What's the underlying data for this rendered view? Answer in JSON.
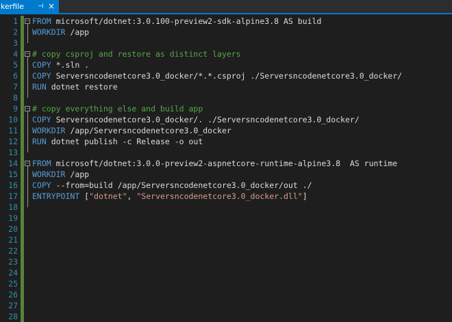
{
  "tab": {
    "title": "kerfile",
    "pin_icon": "pin-icon",
    "close_icon": "close-icon"
  },
  "colors": {
    "keyword": "#569cd6",
    "comment": "#57a64a",
    "string": "#d69d85",
    "text": "#dcdcdc",
    "line_number": "#2b91af",
    "change_bar": "#57823b"
  },
  "lines": [
    {
      "n": "1",
      "segments": [
        {
          "t": "FROM",
          "c": "kw"
        },
        {
          "t": " microsoft/dotnet:3.0.100-preview2-sdk-alpine3.8 AS build",
          "c": "txt"
        }
      ]
    },
    {
      "n": "2",
      "segments": [
        {
          "t": "WORKDIR",
          "c": "kw"
        },
        {
          "t": " /app",
          "c": "txt"
        }
      ]
    },
    {
      "n": "3",
      "segments": []
    },
    {
      "n": "4",
      "segments": [
        {
          "t": "# copy csproj and restore as distinct layers",
          "c": "cmt"
        }
      ]
    },
    {
      "n": "5",
      "segments": [
        {
          "t": "COPY",
          "c": "kw"
        },
        {
          "t": " *.sln .",
          "c": "txt"
        }
      ]
    },
    {
      "n": "6",
      "segments": [
        {
          "t": "COPY",
          "c": "kw"
        },
        {
          "t": " Serversncodenetcore3.0_docker/*.*.csproj ./Serversncodenetcore3.0_docker/",
          "c": "txt"
        }
      ]
    },
    {
      "n": "7",
      "segments": [
        {
          "t": "RUN",
          "c": "kw"
        },
        {
          "t": " dotnet restore",
          "c": "txt"
        }
      ]
    },
    {
      "n": "8",
      "segments": []
    },
    {
      "n": "9",
      "segments": [
        {
          "t": "# copy everything else and build app",
          "c": "cmt"
        }
      ]
    },
    {
      "n": "10",
      "segments": [
        {
          "t": "COPY",
          "c": "kw"
        },
        {
          "t": " Serversncodenetcore3.0_docker/. ./Serversncodenetcore3.0_docker/",
          "c": "txt"
        }
      ]
    },
    {
      "n": "11",
      "segments": [
        {
          "t": "WORKDIR",
          "c": "kw"
        },
        {
          "t": " /app/Serversncodenetcore3.0_docker",
          "c": "txt"
        }
      ]
    },
    {
      "n": "12",
      "segments": [
        {
          "t": "RUN",
          "c": "kw"
        },
        {
          "t": " dotnet publish -c Release -o out",
          "c": "txt"
        }
      ]
    },
    {
      "n": "13",
      "segments": []
    },
    {
      "n": "14",
      "segments": [
        {
          "t": "FROM",
          "c": "kw"
        },
        {
          "t": " microsoft/dotnet:3.0.0-preview2-aspnetcore-runtime-alpine3.8  AS runtime",
          "c": "txt"
        }
      ]
    },
    {
      "n": "15",
      "segments": [
        {
          "t": "WORKDIR",
          "c": "kw"
        },
        {
          "t": " /app",
          "c": "txt"
        }
      ]
    },
    {
      "n": "16",
      "segments": [
        {
          "t": "COPY",
          "c": "kw"
        },
        {
          "t": " --from=build /app/Serversncodenetcore3.0_docker/out ./",
          "c": "txt"
        }
      ]
    },
    {
      "n": "17",
      "segments": [
        {
          "t": "ENTRYPOINT",
          "c": "kw"
        },
        {
          "t": " [",
          "c": "txt"
        },
        {
          "t": "\"dotnet\"",
          "c": "str"
        },
        {
          "t": ", ",
          "c": "txt"
        },
        {
          "t": "\"Serversncodenetcore3.0_docker.dll\"",
          "c": "str"
        },
        {
          "t": "]",
          "c": "txt"
        }
      ]
    },
    {
      "n": "18",
      "segments": []
    },
    {
      "n": "19",
      "segments": []
    },
    {
      "n": "20",
      "segments": []
    },
    {
      "n": "21",
      "segments": []
    },
    {
      "n": "22",
      "segments": []
    },
    {
      "n": "23",
      "segments": []
    },
    {
      "n": "24",
      "segments": []
    },
    {
      "n": "25",
      "segments": []
    },
    {
      "n": "26",
      "segments": []
    },
    {
      "n": "27",
      "segments": []
    },
    {
      "n": "28",
      "segments": []
    }
  ]
}
